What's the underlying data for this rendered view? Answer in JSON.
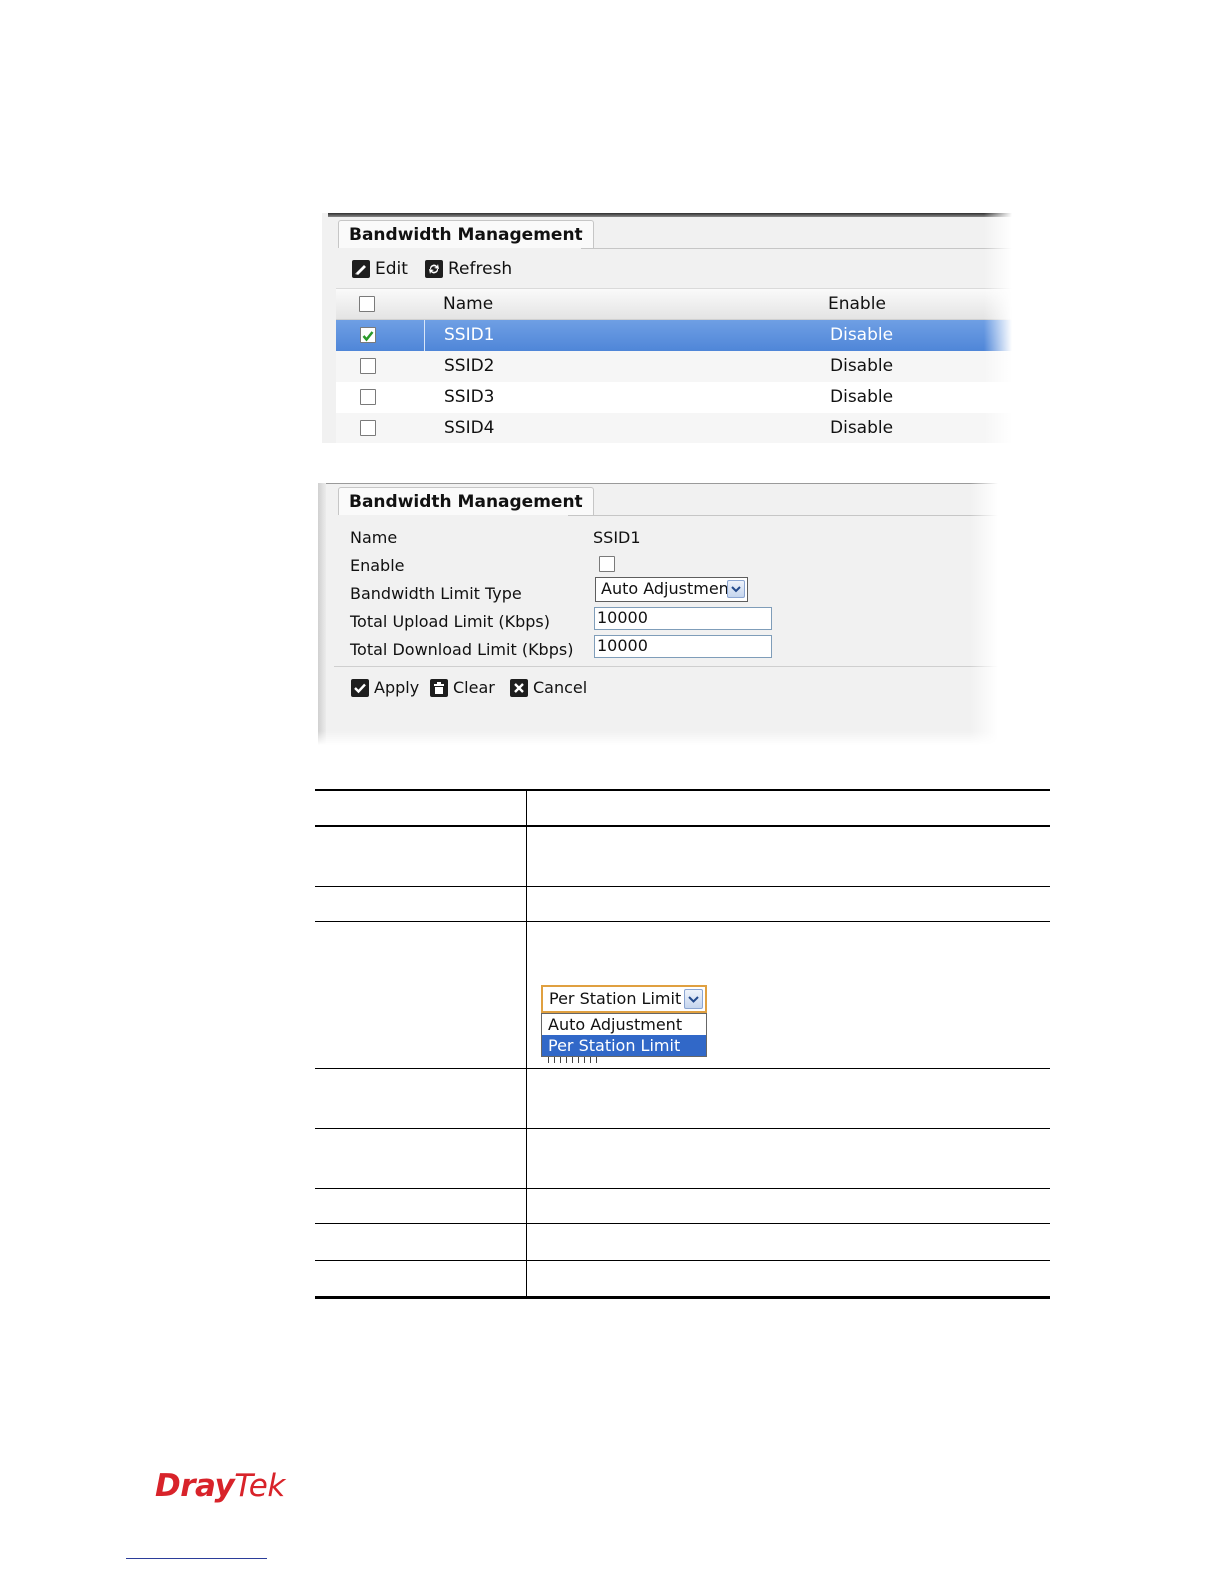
{
  "list_panel": {
    "tab_title": "Bandwidth Management",
    "toolbar": {
      "edit_label": "Edit",
      "refresh_label": "Refresh"
    },
    "columns": {
      "name": "Name",
      "enable": "Enable"
    },
    "rows": [
      {
        "name": "SSID1",
        "enable": "Disable",
        "checked": true,
        "selected": true
      },
      {
        "name": "SSID2",
        "enable": "Disable",
        "checked": false,
        "selected": false
      },
      {
        "name": "SSID3",
        "enable": "Disable",
        "checked": false,
        "selected": false
      },
      {
        "name": "SSID4",
        "enable": "Disable",
        "checked": false,
        "selected": false
      }
    ]
  },
  "edit_panel": {
    "tab_title": "Bandwidth Management",
    "fields": {
      "name_label": "Name",
      "name_value": "SSID1",
      "enable_label": "Enable",
      "limit_type_label": "Bandwidth Limit Type",
      "limit_type_value": "Auto Adjustment",
      "upload_label": "Total Upload Limit (Kbps)",
      "upload_value": "10000",
      "download_label": "Total Download Limit (Kbps)",
      "download_value": "10000"
    },
    "buttons": {
      "apply_label": "Apply",
      "clear_label": "Clear",
      "cancel_label": "Cancel"
    }
  },
  "dropdown_example": {
    "selected": "Per Station Limit",
    "options": [
      "Auto Adjustment",
      "Per Station Limit"
    ]
  },
  "brand": {
    "part1": "Dray",
    "part2": "Tek",
    "color": "#d8232a"
  },
  "colors": {
    "selection": "#4f86d8",
    "highlight": "#3168c8"
  },
  "icons": [
    "edit-icon",
    "refresh-icon",
    "apply-icon",
    "clear-icon",
    "cancel-icon",
    "chevron-down-icon",
    "checkmark-icon"
  ]
}
